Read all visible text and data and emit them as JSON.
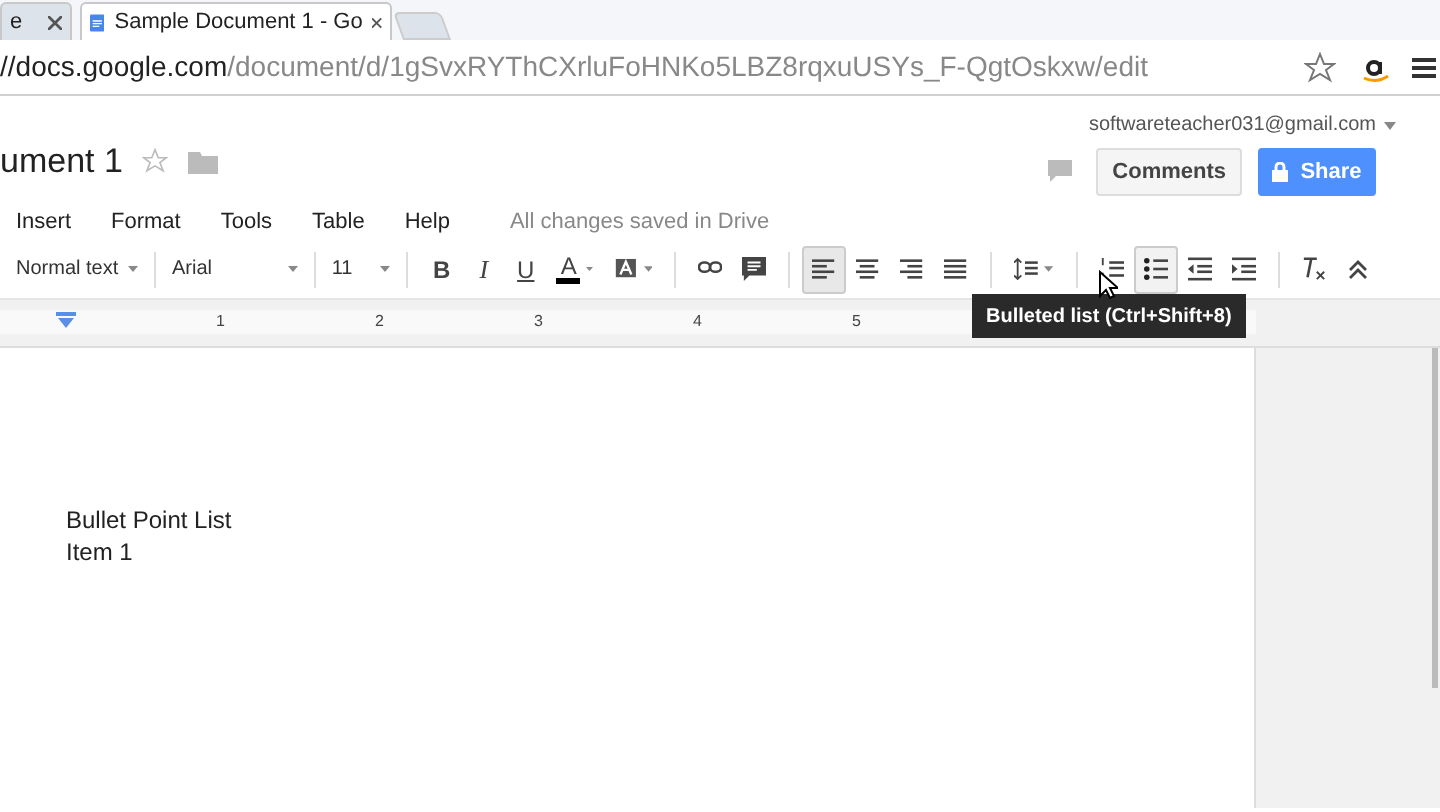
{
  "browser": {
    "tabs": [
      {
        "label": "e",
        "selected": false
      },
      {
        "label": "Sample Document 1 - Go",
        "selected": true
      }
    ],
    "address": {
      "host": "//docs.google.com",
      "path": "/document/d/1gSvxRYThCXrluFoHNKo5LBZ8rqxuUSYs_F-QgtOskxw/edit"
    }
  },
  "doc_header": {
    "title": "ument 1",
    "account": "softwareteacher031@gmail.com",
    "comments_button": "Comments",
    "share_button": "Share"
  },
  "menu": [
    "Insert",
    "Format",
    "Tools",
    "Table",
    "Help"
  ],
  "save_status": "All changes saved in Drive",
  "toolbar": [
    {
      "kind": "dropdown",
      "label": "Normal text"
    },
    {
      "kind": "dropdown",
      "label": "Arial"
    },
    {
      "kind": "dropdown",
      "label": "11"
    },
    {
      "kind": "bold",
      "label": "B"
    },
    {
      "kind": "italic",
      "label": "I"
    },
    {
      "kind": "underline",
      "label": "U"
    },
    {
      "kind": "text_color",
      "label": "A"
    },
    {
      "kind": "highlight"
    },
    {
      "kind": "link"
    },
    {
      "kind": "comment"
    },
    {
      "kind": "align_left",
      "selected": true
    },
    {
      "kind": "align_center",
      "selected": false
    },
    {
      "kind": "align_right",
      "selected": false
    },
    {
      "kind": "align_justify",
      "selected": false
    },
    {
      "kind": "line_spacing"
    },
    {
      "kind": "numbered_list",
      "hovered": false
    },
    {
      "kind": "bulleted_list",
      "hovered": true
    },
    {
      "kind": "decrease_indent"
    },
    {
      "kind": "increase_indent"
    },
    {
      "kind": "clear_formatting"
    }
  ],
  "tooltip": "Bulleted list (Ctrl+Shift+8)",
  "ruler": [
    "1",
    "2",
    "3",
    "4",
    "5"
  ],
  "document": [
    "Bullet Point List",
    "Item 1"
  ]
}
